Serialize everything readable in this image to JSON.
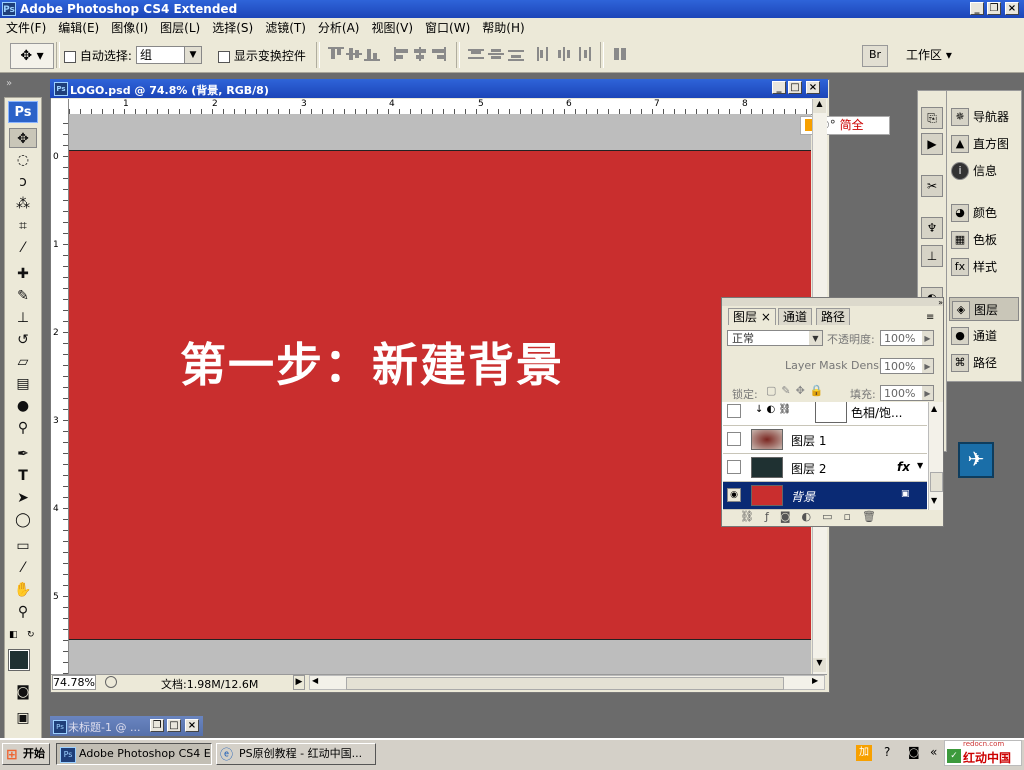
{
  "app": {
    "title": "Adobe Photoshop CS4 Extended",
    "logo": "Ps"
  },
  "menu": [
    "文件(F)",
    "编辑(E)",
    "图像(I)",
    "图层(L)",
    "选择(S)",
    "滤镜(T)",
    "分析(A)",
    "视图(V)",
    "窗口(W)",
    "帮助(H)"
  ],
  "options": {
    "auto_select_label": "自动选择:",
    "auto_select_value": "组",
    "show_transform_label": "显示变换控件",
    "workspace_label": "工作区"
  },
  "document": {
    "title": "LOGO.psd @ 74.8% (背景, RGB/8)",
    "canvas_text": "第一步：新建背景",
    "canvas_color": "#c92e2e",
    "ruler_h": [
      "1",
      "2",
      "3",
      "4",
      "5",
      "6",
      "7",
      "8"
    ],
    "ruler_v": [
      "0",
      "1",
      "2",
      "3",
      "4",
      "5"
    ],
    "zoom": "74.78%",
    "doc_size": "文档:1.98M/12.6M"
  },
  "ime": {
    "text": "简全"
  },
  "dock_right": {
    "items": [
      {
        "label": "导航器",
        "icon": "navigator-icon"
      },
      {
        "label": "直方图",
        "icon": "histogram-icon"
      },
      {
        "label": "信息",
        "icon": "info-icon"
      },
      {
        "label": "颜色",
        "icon": "color-icon"
      },
      {
        "label": "色板",
        "icon": "swatches-icon"
      },
      {
        "label": "样式",
        "icon": "styles-icon"
      },
      {
        "label": "图层",
        "icon": "layers-icon"
      },
      {
        "label": "通道",
        "icon": "channels-icon"
      },
      {
        "label": "路径",
        "icon": "paths-icon"
      }
    ]
  },
  "layers_panel": {
    "tabs": [
      "图层",
      "通道",
      "路径"
    ],
    "blend_mode": "正常",
    "opacity_label": "不透明度:",
    "opacity_value": "100%",
    "mask_density_label": "Layer Mask Density",
    "mask_density_value": "100%",
    "lock_label": "锁定:",
    "fill_label": "填充:",
    "fill_value": "100%",
    "layers": [
      {
        "name": "色相/饱...",
        "visible": false,
        "thumb_color": "#ffffff"
      },
      {
        "name": "图层 1",
        "visible": false,
        "thumb_color": "#8a3b33"
      },
      {
        "name": "图层 2",
        "visible": false,
        "thumb_color": "#1f3132",
        "fx": "fx"
      },
      {
        "name": "背景",
        "visible": true,
        "thumb_color": "#c92e2e",
        "selected": true
      }
    ]
  },
  "minidoc": {
    "title": "未标题-1 @ ..."
  },
  "taskbar": {
    "start": "开始",
    "buttons": [
      "Adobe Photoshop CS4 E...",
      "PS原创教程 - 红动中国..."
    ],
    "tray_text": "红动中国",
    "watermark": "redocn.com"
  },
  "colors": {
    "title_blue": "#2f64d9",
    "panel_bg": "#ece9d8",
    "layer_selected": "#0a2a74"
  }
}
